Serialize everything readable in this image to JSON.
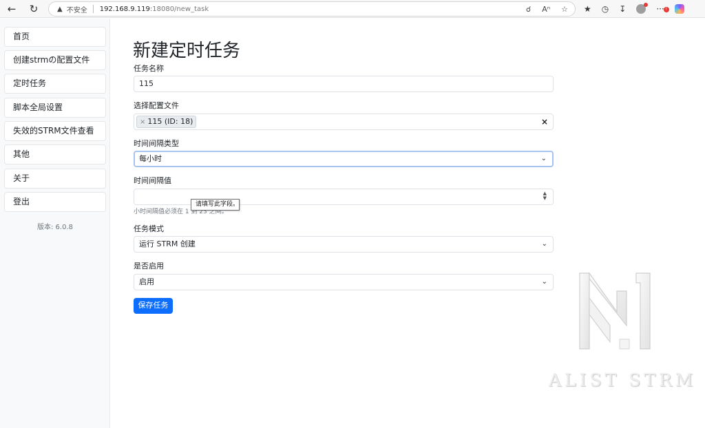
{
  "browser": {
    "insecure_label": "不安全",
    "url_host": "192.168.9.119",
    "url_rest": ":18080/new_task",
    "icons": [
      "back-icon",
      "reload-icon",
      "warning-icon",
      "zoom-icon",
      "read-aloud-icon",
      "favorite-icon",
      "favorites-list-icon",
      "history-icon",
      "download-icon",
      "profile-icon",
      "more-icon",
      "copilot-icon"
    ]
  },
  "sidebar": {
    "items": [
      {
        "label": "首页"
      },
      {
        "label": "创建strmの配置文件"
      },
      {
        "label": "定时任务"
      },
      {
        "label": "脚本全局设置"
      },
      {
        "label": "失效的STRM文件查看"
      },
      {
        "label": "其他"
      },
      {
        "label": "关于"
      },
      {
        "label": "登出"
      }
    ],
    "version": "版本: 6.0.8"
  },
  "form": {
    "title": "新建定时任务",
    "task_name": {
      "label": "任务名称",
      "value": "115"
    },
    "config_file": {
      "label": "选择配置文件",
      "tag": "115 (ID: 18)",
      "tag_remove": "×",
      "clear": "×"
    },
    "interval_type": {
      "label": "时间间隔类型",
      "value": "每小时"
    },
    "interval_value": {
      "label": "时间间隔值",
      "value": "",
      "help": "小时间隔值必须在 1 到 23 之间。",
      "tooltip": "请填写此字段。"
    },
    "task_mode": {
      "label": "任务模式",
      "value": "运行 STRM 创建"
    },
    "enabled": {
      "label": "是否启用",
      "value": "启用"
    },
    "save_label": "保存任务"
  },
  "watermark": {
    "text": "ALIST STRM"
  },
  "colors": {
    "primary": "#0d6efd",
    "focus_border": "#a7c3f0",
    "sidebar_bg": "#f8f9fa"
  }
}
